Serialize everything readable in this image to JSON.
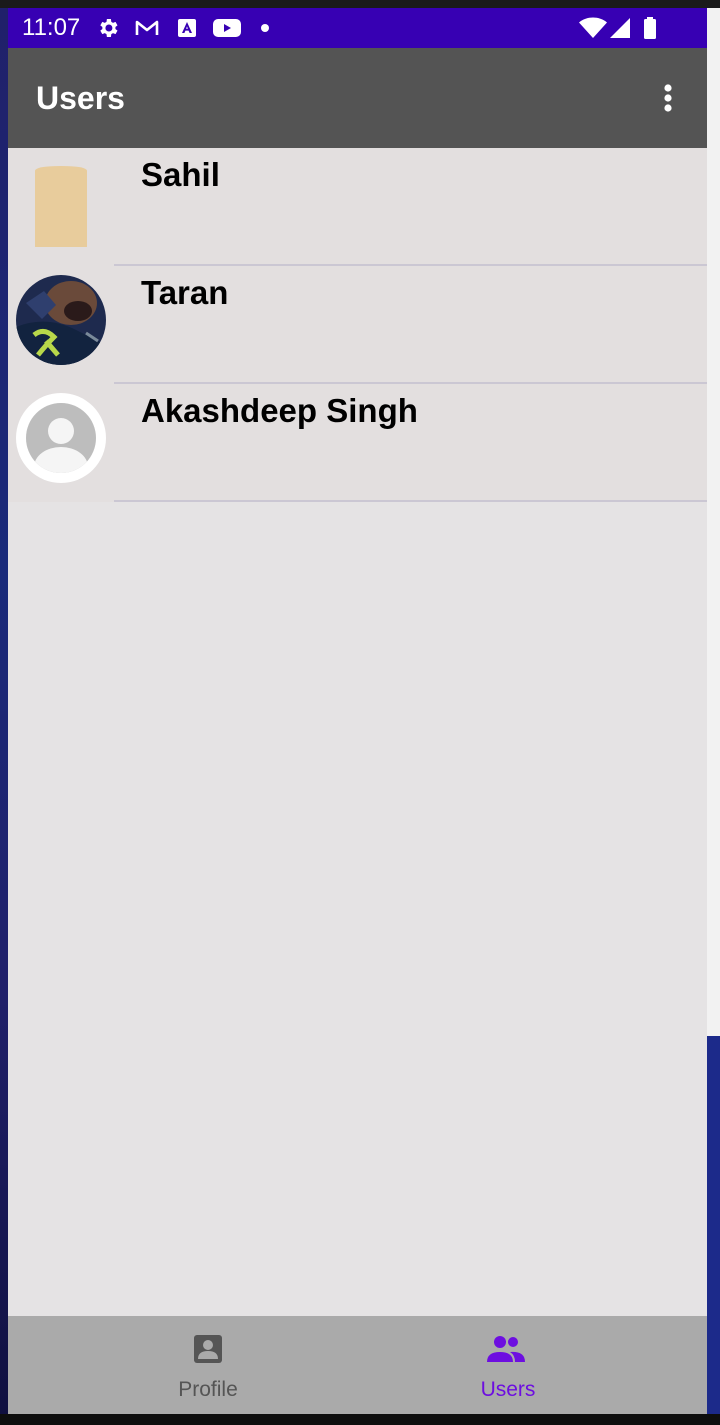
{
  "status_bar": {
    "time": "11:07",
    "icons": [
      "gear-icon",
      "gmail-icon",
      "a-box-icon",
      "youtube-icon",
      "dot-icon",
      "wifi-icon",
      "signal-icon",
      "battery-icon"
    ]
  },
  "app_bar": {
    "title": "Users",
    "menu_icon": "more-vert-icon"
  },
  "users": [
    {
      "name": "Sahil",
      "avatar": "placeholder-tan"
    },
    {
      "name": "Taran",
      "avatar": "photo"
    },
    {
      "name": "Akashdeep Singh",
      "avatar": "default-person"
    }
  ],
  "bottom_nav": {
    "items": [
      {
        "label": "Profile",
        "icon": "account-box-icon",
        "selected": false
      },
      {
        "label": "Users",
        "icon": "group-icon",
        "selected": true
      }
    ]
  },
  "colors": {
    "status_bar": "#3700b3",
    "app_bar": "#545454",
    "screen_bg": "#e5e3e4",
    "row_bg": "#e3dfdf",
    "bottom_nav": "#aaaaaa",
    "accent": "#6d0ee0"
  }
}
